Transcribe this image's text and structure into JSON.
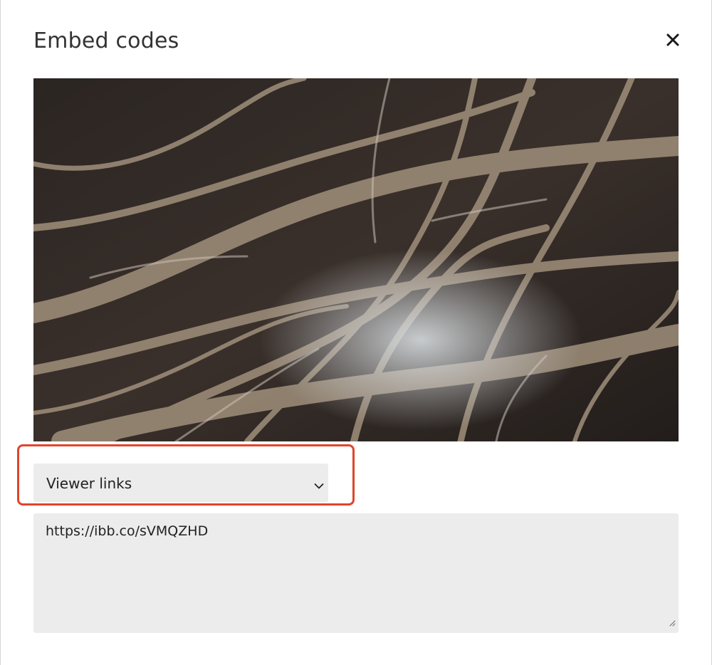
{
  "dialog": {
    "title": "Embed codes",
    "close_icon": "close-icon"
  },
  "preview": {
    "icon": "image-preview"
  },
  "format_select": {
    "selected": "Viewer links",
    "icon": "chevron-down-icon",
    "highlight_color": "#e0452b"
  },
  "embed_code": {
    "value": "https://ibb.co/sVMQZHD",
    "icon": "resize-grip-icon"
  },
  "colors": {
    "field_bg": "#ececec",
    "text": "#222222"
  }
}
